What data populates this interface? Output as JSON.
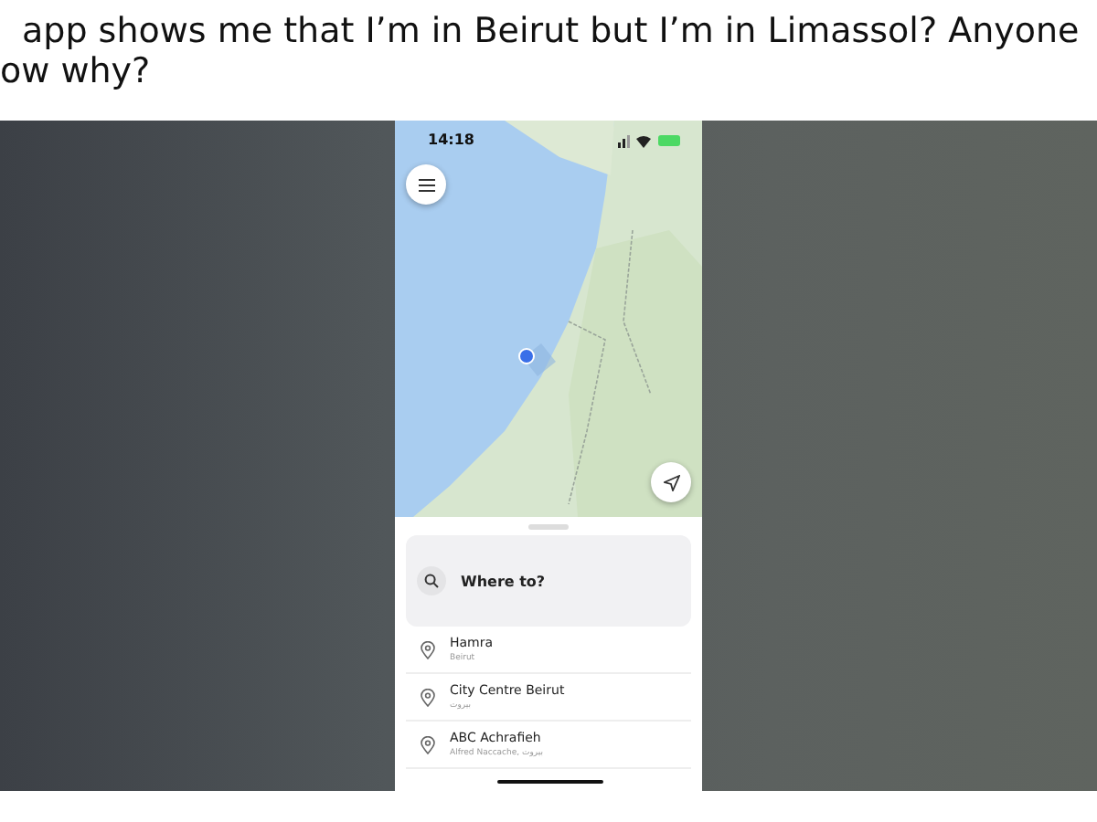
{
  "post": {
    "lines": [
      "app shows me that I’m in Beirut but I’m in Limassol? Anyone",
      "ow why?"
    ]
  },
  "phone": {
    "status_time": "14:18",
    "search": {
      "placeholder": "Where to?"
    },
    "places": [
      {
        "name": "Hamra",
        "detail": "Beirut"
      },
      {
        "name": "City Centre Beirut",
        "detail": "بيروت"
      },
      {
        "name": "ABC Achrafieh",
        "detail": "Alfred Naccache, بيروت"
      }
    ]
  }
}
